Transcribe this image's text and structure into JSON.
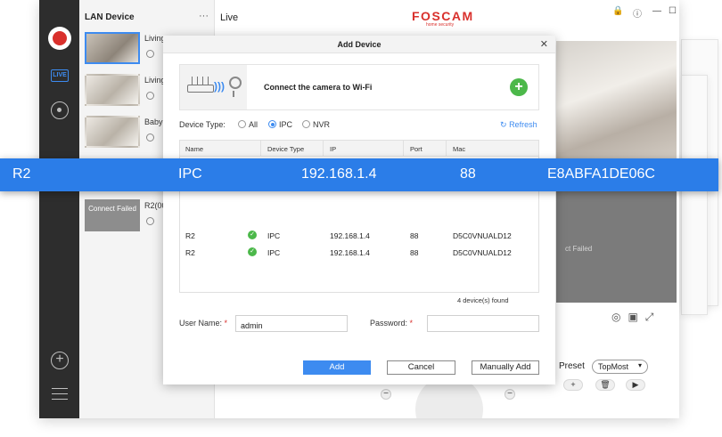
{
  "app": {
    "panel_title": "LAN Device",
    "more_label": "···",
    "live_label": "Live",
    "brand": "FOSCAM",
    "brand_sub": "home security",
    "live_icon_text": "LIVE"
  },
  "devices": [
    {
      "name": "Living",
      "status": "online"
    },
    {
      "name": "Living",
      "status": "online"
    },
    {
      "name": "Baby",
      "status": "online"
    },
    {
      "name": "R2(00",
      "status": "Connect Failed"
    }
  ],
  "preview": {
    "failed_text": "ct Failed",
    "preset_label": "Preset",
    "preset_value": "TopMost"
  },
  "dialog": {
    "title": "Add Device",
    "wifi_text": "Connect the camera to Wi-Fi",
    "device_type_label": "Device Type:",
    "types": [
      "All",
      "IPC",
      "NVR"
    ],
    "selected_type": "IPC",
    "refresh_label": "Refresh",
    "columns": [
      "Name",
      "Device Type",
      "IP",
      "Port",
      "Mac"
    ],
    "rows": [
      {
        "name": "R2",
        "type": "IPC",
        "ip": "192.168.1.4",
        "port": "88",
        "mac": "D5C0VNUALD12"
      },
      {
        "name": "R2",
        "type": "IPC",
        "ip": "192.168.1.4",
        "port": "88",
        "mac": "D5C0VNUALD12"
      }
    ],
    "found_text": "4 device(s) found",
    "username_label": "User Name:",
    "username_value": "admin",
    "password_label": "Password:",
    "password_value": "",
    "add_label": "Add",
    "cancel_label": "Cancel",
    "manual_label": "Manually Add"
  },
  "highlight": {
    "name": "R2",
    "type": "IPC",
    "ip": "192.168.1.4",
    "port": "88",
    "mac": "E8ABFA1DE06C"
  },
  "colors": {
    "accent": "#3d8bf0",
    "highlight": "#2b7de8",
    "brand": "#d9302c",
    "success": "#4cb84a"
  }
}
